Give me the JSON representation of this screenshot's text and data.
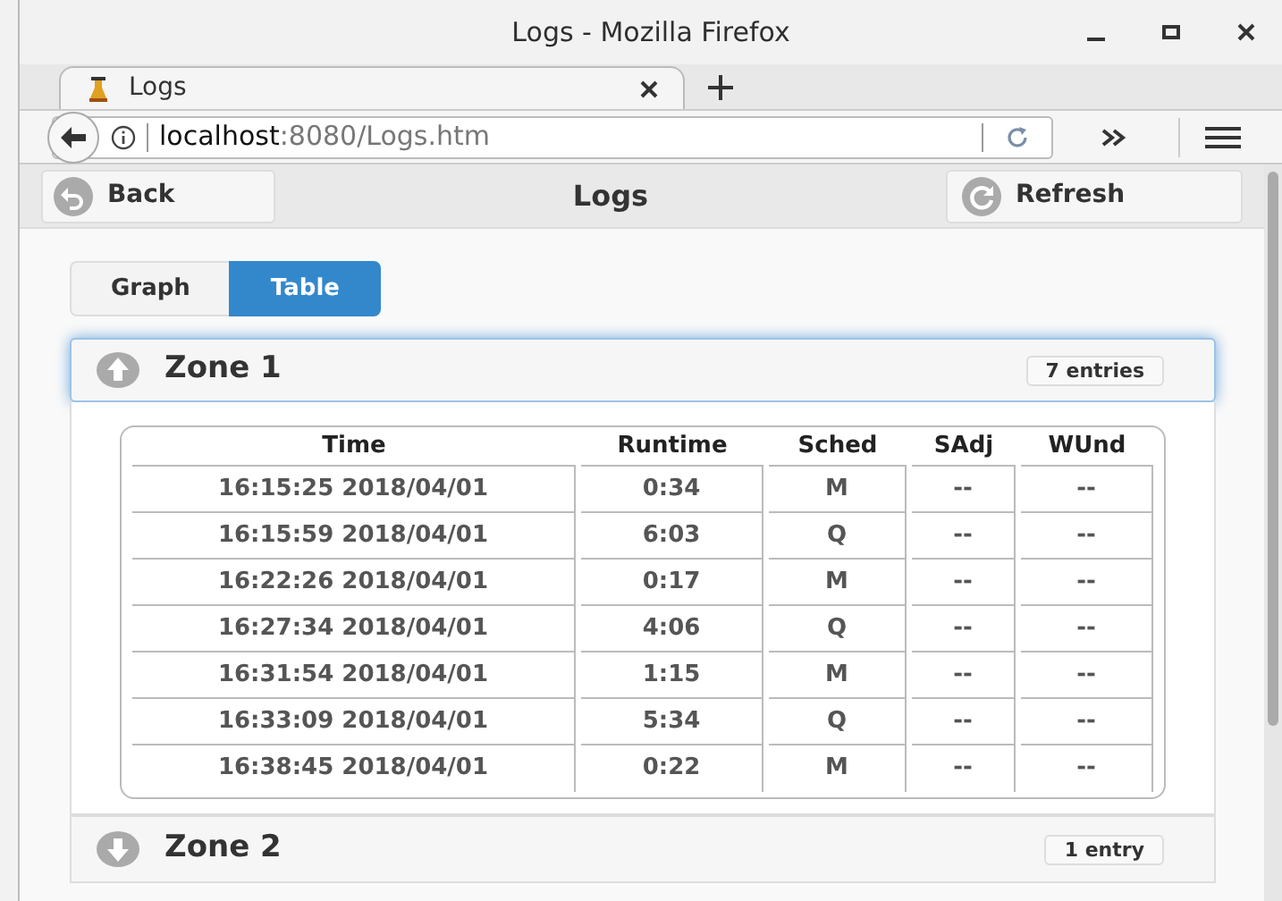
{
  "window": {
    "title": "Logs - Mozilla Firefox"
  },
  "tabs": [
    {
      "label": "Logs",
      "selected": true
    }
  ],
  "address_bar": {
    "host": "localhost",
    "path": ":8080/Logs.htm"
  },
  "header": {
    "back": "Back",
    "title": "Logs",
    "refresh": "Refresh"
  },
  "view_toggle": [
    {
      "label": "Graph",
      "selected": false
    },
    {
      "label": "Table",
      "selected": true
    }
  ],
  "zones": [
    {
      "title": "Zone 1",
      "count": "7 entries",
      "expanded": true,
      "table": {
        "columns": [
          "Time",
          "Runtime",
          "Sched",
          "SAdj",
          "WUnd"
        ],
        "rows": [
          [
            "16:15:25 2018/04/01",
            "0:34",
            "M",
            "--",
            "--"
          ],
          [
            "16:15:59 2018/04/01",
            "6:03",
            "Q",
            "--",
            "--"
          ],
          [
            "16:22:26 2018/04/01",
            "0:17",
            "M",
            "--",
            "--"
          ],
          [
            "16:27:34 2018/04/01",
            "4:06",
            "Q",
            "--",
            "--"
          ],
          [
            "16:31:54 2018/04/01",
            "1:15",
            "M",
            "--",
            "--"
          ],
          [
            "16:33:09 2018/04/01",
            "5:34",
            "Q",
            "--",
            "--"
          ],
          [
            "16:38:45 2018/04/01",
            "0:22",
            "M",
            "--",
            "--"
          ]
        ]
      }
    },
    {
      "title": "Zone 2",
      "count": "1 entry",
      "expanded": false
    }
  ]
}
